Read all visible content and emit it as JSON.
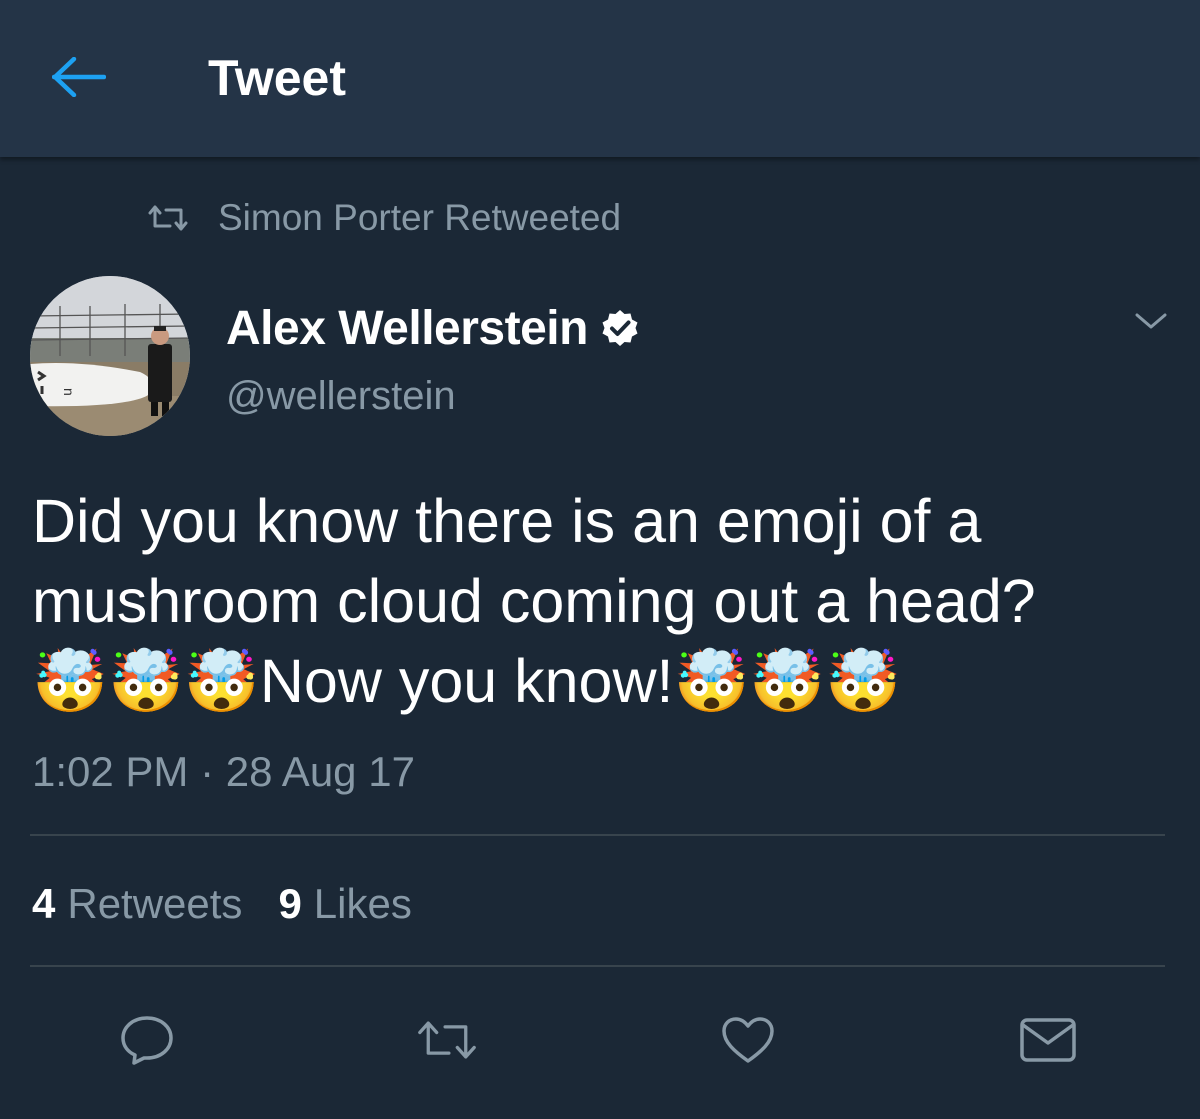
{
  "header": {
    "title": "Tweet",
    "back_icon": "arrow-left-icon"
  },
  "retweet_context": {
    "icon": "retweet-icon",
    "text": "Simon Porter Retweeted"
  },
  "tweet": {
    "author": {
      "name": "Alex Wellerstein",
      "handle": "@wellerstein",
      "verified": true
    },
    "text": "Did you know there is an emoji of a mushroom cloud coming out a head?\n🤯🤯🤯Now you know!🤯🤯🤯",
    "timestamp": "1:02 PM · 28 Aug 17"
  },
  "stats": {
    "retweets_count": "4",
    "retweets_label": "Retweets",
    "likes_count": "9",
    "likes_label": "Likes"
  },
  "actions": [
    "reply-icon",
    "retweet-icon",
    "like-icon",
    "share-icon"
  ],
  "colors": {
    "background": "#1b2836",
    "header_background": "#243447",
    "accent": "#1da1f2",
    "secondary_text": "#8899a6",
    "divider": "#38444d"
  }
}
